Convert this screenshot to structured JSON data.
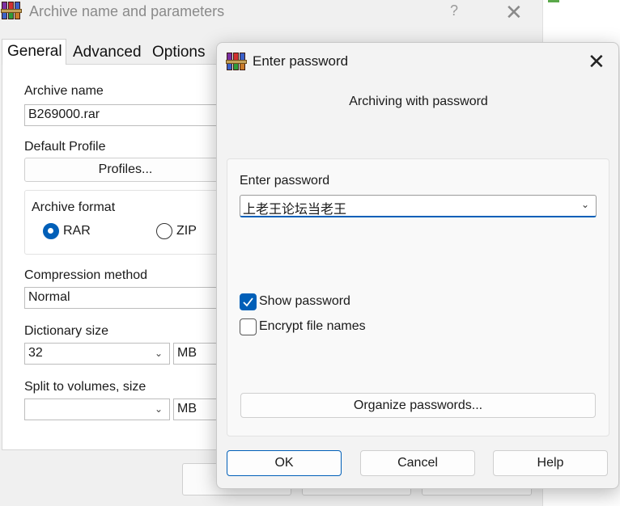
{
  "background_dialog": {
    "title": "Archive name and parameters",
    "help_glyph": "?",
    "close_glyph": "✕",
    "tabs": [
      "General",
      "Advanced",
      "Options"
    ],
    "archive_name_label": "Archive name",
    "archive_name_value": "B269000.rar",
    "default_profile_label": "Default Profile",
    "profiles_button": "Profiles...",
    "archive_format_label": "Archive format",
    "format_options": [
      "RAR",
      "ZIP"
    ],
    "format_selected": "RAR",
    "compression_label": "Compression method",
    "compression_value": "Normal",
    "dictionary_label": "Dictionary size",
    "dictionary_value": "32",
    "dictionary_unit": "MB",
    "split_label": "Split to volumes, size",
    "split_value": "",
    "split_unit": "MB"
  },
  "password_dialog": {
    "title": "Enter password",
    "close_glyph": "✕",
    "subtitle": "Archiving with password",
    "password_label": "Enter password",
    "password_value": "上老王论坛当老王",
    "show_password_label": "Show password",
    "show_password_checked": true,
    "encrypt_names_label": "Encrypt file names",
    "encrypt_names_checked": false,
    "organize_button": "Organize passwords...",
    "ok_button": "OK",
    "cancel_button": "Cancel",
    "help_button": "Help",
    "accent_color": "#005fb8"
  }
}
